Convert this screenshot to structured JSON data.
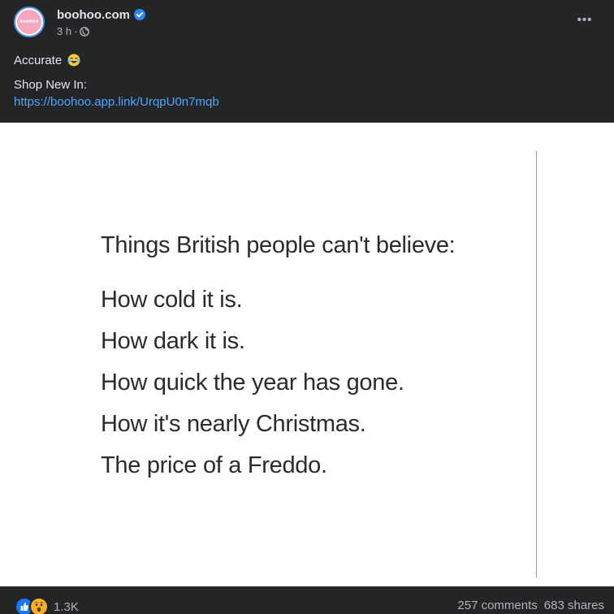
{
  "post": {
    "page_name": "boohoo.com",
    "avatar_text": "boohoo",
    "time": "3 h",
    "separator": "·",
    "more_label": "•••",
    "caption": "Accurate",
    "shop_label": "Shop New In:",
    "link": "https://boohoo.app.link/UrqpU0n7mqb",
    "icons": {
      "verified": "verified-badge-icon",
      "audience": "globe-icon",
      "caption_emoji": "laughing-crying-emoji"
    }
  },
  "image": {
    "title": "Things British people can't believe:",
    "lines": [
      "How cold it is.",
      "How dark it is.",
      "How quick the year has gone.",
      "How it's nearly Christmas.",
      "The price of a Freddo."
    ]
  },
  "footer": {
    "reaction_count": "1.3K",
    "comments": "257 comments",
    "shares": "683 shares",
    "reaction_icons": [
      "like-icon",
      "wow-icon"
    ]
  },
  "colors": {
    "background": "#242526",
    "link": "#4ea5ff",
    "like": "#1877f2",
    "wow": "#f7b125",
    "avatar_pink": "#f6a6bf"
  }
}
